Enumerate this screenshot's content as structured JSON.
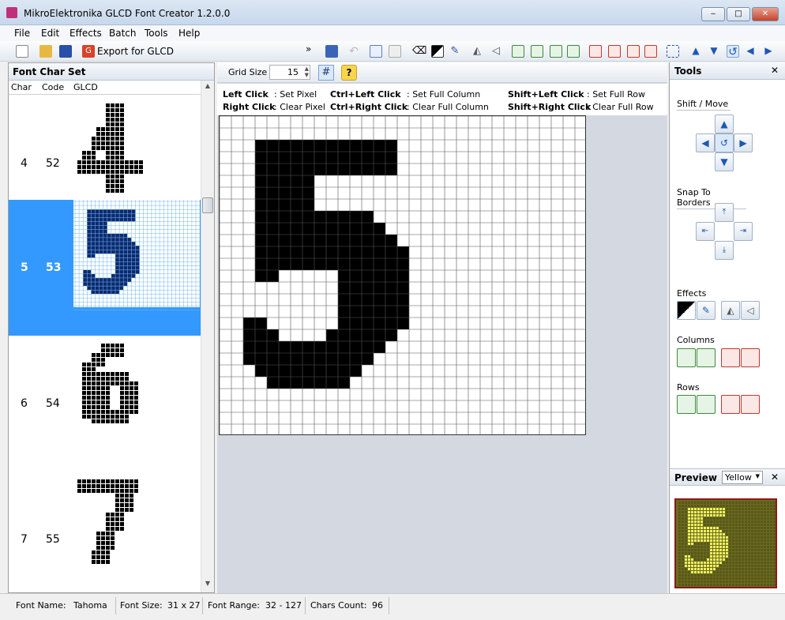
{
  "window": {
    "title": "MikroElektronika GLCD Font Creator 1.2.0.0",
    "min": "‒",
    "max": "□",
    "close": "✕"
  },
  "menu": [
    "File",
    "Edit",
    "Effects",
    "Batch",
    "Tools",
    "Help"
  ],
  "toolbar": {
    "export_label": "Export for GLCD",
    "overflow": "»"
  },
  "grid_toolbar": {
    "label": "Grid Size",
    "value": "15"
  },
  "left_panel": {
    "title": "Font Char Set",
    "columns": [
      "Char",
      "Code",
      "GLCD"
    ],
    "rows": [
      {
        "char": "4",
        "code": "52"
      },
      {
        "char": "5",
        "code": "53"
      },
      {
        "char": "6",
        "code": "54"
      },
      {
        "char": "7",
        "code": "55"
      }
    ]
  },
  "help": [
    {
      "key": "Left Click",
      "action": ": Set Pixel"
    },
    {
      "key": "Right Click",
      "action": ": Clear Pixel"
    },
    {
      "key": "Ctrl+Left Click",
      "action": ": Set Full Column"
    },
    {
      "key": "Ctrl+Right Click",
      "action": ": Clear Full Column"
    },
    {
      "key": "Shift+Left Click",
      "action": ": Set Full Row"
    },
    {
      "key": "Shift+Right Click",
      "action": ": Clear Full Row"
    }
  ],
  "tools": {
    "title": "Tools",
    "close": "✕",
    "shift_move": "Shift / Move",
    "snap": "Snap To Borders",
    "effects": "Effects",
    "columns": "Columns",
    "rows": "Rows"
  },
  "preview": {
    "title": "Preview",
    "color": "Yellow",
    "close": "✕"
  },
  "status": {
    "font_name_label": "Font Name:",
    "font_name": "Tahoma",
    "font_size_label": "Font Size:",
    "font_size": "31 x 27",
    "font_range_label": "Font Range:",
    "font_range": "32 - 127",
    "chars_count_label": "Chars Count:",
    "chars_count": "96"
  },
  "colors": {
    "selection": "#3399ff",
    "pixel_on": "#000000",
    "preview_bg": "#6b6b1f",
    "preview_on": "#f0f060"
  }
}
